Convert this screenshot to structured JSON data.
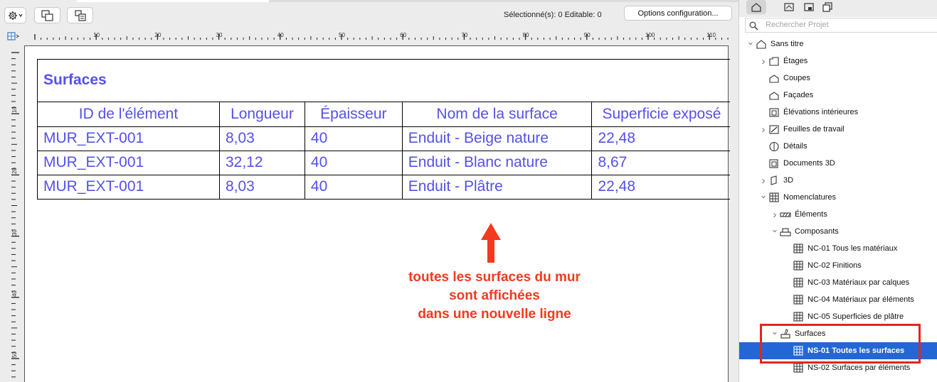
{
  "toolbar": {
    "selection_status": "Sélectionné(s): 0  Editable: 0",
    "options_button": "Options configuration..."
  },
  "ruler": {
    "top_labels": [
      "10",
      "20",
      "30",
      "40",
      "50",
      "60",
      "70",
      "80",
      "90",
      "100",
      "110"
    ],
    "left_labels": [
      "10",
      "20",
      "30",
      "40",
      "50"
    ]
  },
  "schedule": {
    "title": "Surfaces",
    "columns": [
      "ID de l'élément",
      "Longueur",
      "Épaisseur",
      "Nom de la surface",
      "Superficie exposé"
    ],
    "rows": [
      [
        "MUR_EXT-001",
        "8,03",
        "40",
        "Enduit - Beige nature",
        "22,48"
      ],
      [
        "MUR_EXT-001",
        "32,12",
        "40",
        "Enduit - Blanc nature",
        "8,67"
      ],
      [
        "MUR_EXT-001",
        "8,03",
        "40",
        "Enduit - Plâtre",
        "22,48"
      ]
    ],
    "text_color": "#5451ea"
  },
  "annotation": {
    "lines": [
      "toutes les surfaces du mur",
      "sont affichées",
      "dans une nouvelle ligne"
    ],
    "color": "#f23a1f"
  },
  "navigator": {
    "search_placeholder": "Rechercher Projet",
    "items": [
      {
        "label": "Sans titre",
        "icon": "house-icon",
        "indent": 0,
        "chevron": "down"
      },
      {
        "label": "Étages",
        "icon": "floors-icon",
        "indent": 1,
        "chevron": "right"
      },
      {
        "label": "Coupes",
        "icon": "section-icon",
        "indent": 1,
        "chevron": ""
      },
      {
        "label": "Façades",
        "icon": "elevation-icon",
        "indent": 1,
        "chevron": ""
      },
      {
        "label": "Élévations intérieures",
        "icon": "interior-elevation-icon",
        "indent": 1,
        "chevron": ""
      },
      {
        "label": "Feuilles de travail",
        "icon": "worksheet-icon",
        "indent": 1,
        "chevron": "right"
      },
      {
        "label": "Détails",
        "icon": "detail-icon",
        "indent": 1,
        "chevron": ""
      },
      {
        "label": "Documents 3D",
        "icon": "document-3d-icon",
        "indent": 1,
        "chevron": ""
      },
      {
        "label": "3D",
        "icon": "cube-3d-icon",
        "indent": 1,
        "chevron": "right"
      },
      {
        "label": "Nomenclatures",
        "icon": "schedule-icon",
        "indent": 1,
        "chevron": "down"
      },
      {
        "label": "Éléments",
        "icon": "elements-icon",
        "indent": 2,
        "chevron": "right"
      },
      {
        "label": "Composants",
        "icon": "components-icon",
        "indent": 2,
        "chevron": "down"
      },
      {
        "label": "NC-01 Tous les matériaux",
        "icon": "schedule-icon",
        "indent": 3,
        "chevron": ""
      },
      {
        "label": "NC-02 Finitions",
        "icon": "schedule-icon",
        "indent": 3,
        "chevron": ""
      },
      {
        "label": "NC-03 Matériaux par calques",
        "icon": "schedule-icon",
        "indent": 3,
        "chevron": ""
      },
      {
        "label": "NC-04 Matériaux par éléments",
        "icon": "schedule-icon",
        "indent": 3,
        "chevron": ""
      },
      {
        "label": "NC-05 Superficies de plâtre",
        "icon": "schedule-icon",
        "indent": 3,
        "chevron": ""
      },
      {
        "label": "Surfaces",
        "icon": "surfaces-icon",
        "indent": 2,
        "chevron": "down"
      },
      {
        "label": "NS-01 Toutes les surfaces",
        "icon": "schedule-icon",
        "indent": 3,
        "chevron": "",
        "selected": true
      },
      {
        "label": "NS-02 Surfaces par éléments",
        "icon": "schedule-icon",
        "indent": 3,
        "chevron": ""
      }
    ],
    "selected_color": "#2367d6",
    "highlight_color": "#e32619"
  }
}
